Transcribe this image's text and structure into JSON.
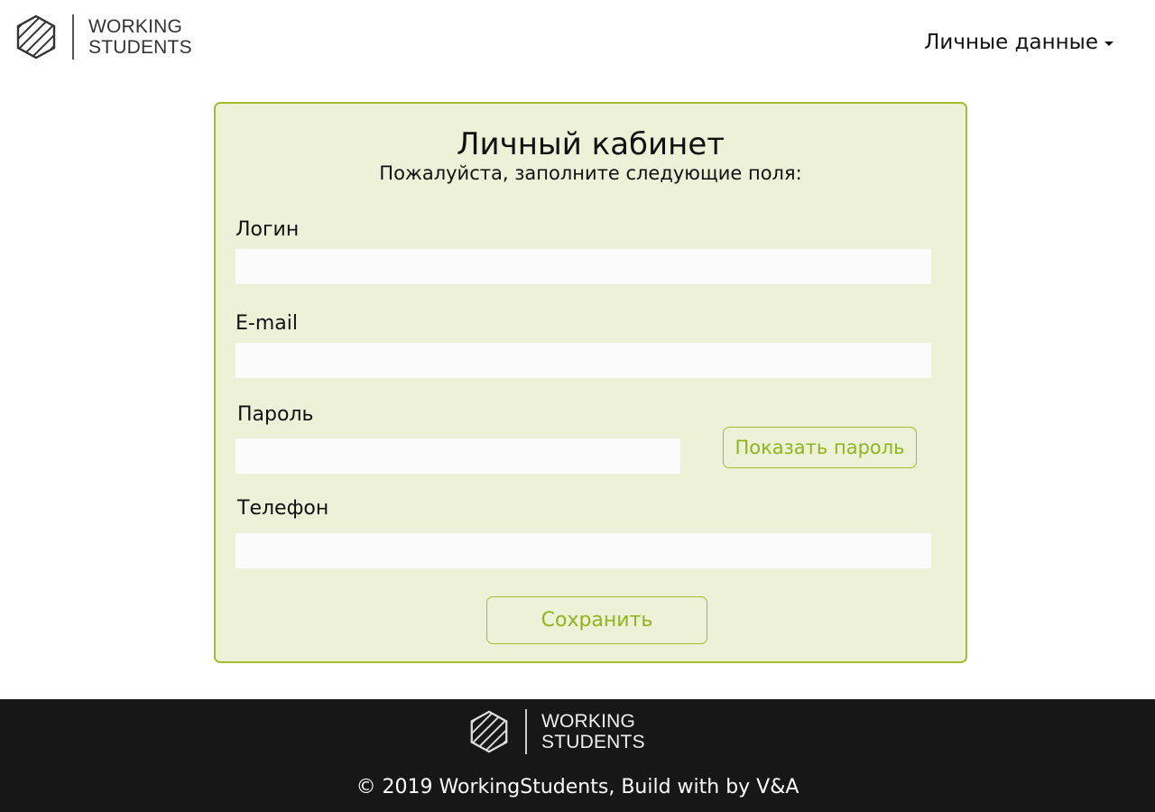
{
  "header": {
    "logo": {
      "line1": "WORKING",
      "line2": "STUDENTS"
    },
    "user_menu_label": "Личные данные"
  },
  "panel": {
    "title": "Личный кабинет",
    "subtitle": "Пожалуйста, заполните следующие поля:",
    "fields": {
      "login": {
        "label": "Логин",
        "value": "",
        "placeholder": ""
      },
      "email": {
        "label": "E-mail",
        "value": "",
        "placeholder": ""
      },
      "password": {
        "label": "Пароль",
        "value": "",
        "placeholder": ""
      },
      "phone": {
        "label": "Телефон",
        "value": "",
        "placeholder": ""
      }
    },
    "show_password_label": "Показать пароль",
    "save_label": "Сохранить"
  },
  "footer": {
    "logo": {
      "line1": "WORKING",
      "line2": "STUDENTS"
    },
    "copyright": "© 2019 WorkingStudents, Build with by V&A"
  },
  "colors": {
    "accent": "#a3bd2c",
    "accent_text": "#8fb41c",
    "panel_bg": "#edf1d8",
    "footer_bg": "#171717"
  },
  "icons": {
    "logo": "striped-hexagon-logo-icon",
    "dropdown": "caret-down-icon"
  }
}
